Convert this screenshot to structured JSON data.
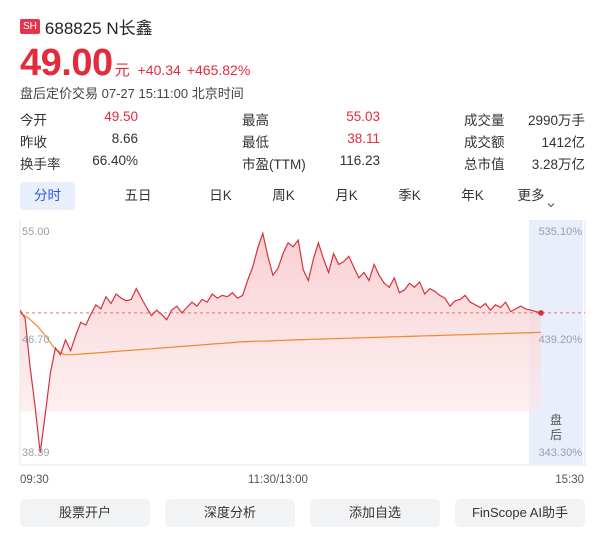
{
  "stock": {
    "exchange_badge": "SH",
    "code_name": "688825 N长鑫",
    "price": "49.00",
    "price_unit": "元",
    "change": "+40.34",
    "change_pct": "+465.82%",
    "trade_status": "盘后定价交易 07-27 15:11:00 北京时间"
  },
  "stats": [
    [
      {
        "label": "今开",
        "value": "49.50",
        "color": "red"
      },
      {
        "label": "最高",
        "value": "55.03",
        "color": "red"
      },
      {
        "label": "成交量",
        "value": "2990万手",
        "color": "normal"
      }
    ],
    [
      {
        "label": "昨收",
        "value": "8.66",
        "color": "normal"
      },
      {
        "label": "最低",
        "value": "38.11",
        "color": "red"
      },
      {
        "label": "成交额",
        "value": "1412亿",
        "color": "normal"
      }
    ],
    [
      {
        "label": "换手率",
        "value": "66.40%",
        "color": "normal"
      },
      {
        "label": "市盈(TTM)",
        "value": "116.23",
        "color": "normal"
      },
      {
        "label": "总市值",
        "value": "3.28万亿",
        "color": "normal"
      }
    ]
  ],
  "tabs": [
    "分时",
    "五日",
    "日K",
    "周K",
    "月K",
    "季K",
    "年K",
    "更多"
  ],
  "active_tab": 0,
  "chart": {
    "price_labels": [
      "55.00",
      "46.70",
      "38.39"
    ],
    "pct_labels": [
      "535.10%",
      "439.20%",
      "343.30%"
    ],
    "time_labels": [
      "09:30",
      "11:30/13:00",
      "15:30"
    ],
    "after_hours_label": [
      "盘",
      "后"
    ],
    "colors": {
      "price_line": "#d7313e",
      "avg_line": "#ee8a26",
      "ref_line": "#ea6f7a",
      "after_hours_bg": "#e9eefb",
      "label_color": "#9aa0a8"
    }
  },
  "chart_data": {
    "type": "line",
    "xlabel": "",
    "ylabel": "",
    "ylim": [
      38.39,
      55.0
    ],
    "reference_price": 49.0,
    "x_ticks": [
      "09:30",
      "11:30/13:00",
      "15:30"
    ],
    "series": [
      {
        "values": [
          49.2,
          48.6,
          45.0,
          42.0,
          38.6,
          41.5,
          44.5,
          46.4,
          45.9,
          47.0,
          46.2,
          47.3,
          48.3,
          48.1,
          48.9,
          49.6,
          49.3,
          50.2,
          49.7,
          50.4,
          50.1,
          49.9,
          50.0,
          50.8,
          50.1,
          49.4,
          48.8,
          49.2,
          48.9,
          48.5,
          49.2,
          49.5,
          49.0,
          49.4,
          49.8,
          49.5,
          50.0,
          49.8,
          50.4,
          50.1,
          50.3,
          50.2,
          50.5,
          50.1,
          50.3,
          51.4,
          52.4,
          53.8,
          54.9,
          53.2,
          51.8,
          52.3,
          53.4,
          54.2,
          53.9,
          54.4,
          52.2,
          51.4,
          53.0,
          54.2,
          53.0,
          52.0,
          53.4,
          52.6,
          52.8,
          53.2,
          52.4,
          51.6,
          52.0,
          51.4,
          52.6,
          51.8,
          51.2,
          50.9,
          51.6,
          50.5,
          50.7,
          51.2,
          50.9,
          51.3,
          50.4,
          50.8,
          50.6,
          50.3,
          50.1,
          49.5,
          49.9,
          50.0,
          50.3,
          49.8,
          49.6,
          49.4,
          49.7,
          49.2,
          49.6,
          49.4,
          49.8,
          49.1,
          49.3,
          49.5,
          49.3,
          49.2,
          49.1,
          49.0
        ]
      },
      {
        "values": [
          49.0,
          48.6,
          48.0,
          47.2,
          46.3,
          45.9,
          45.9,
          45.95,
          46.0,
          46.05,
          46.1,
          46.15,
          46.2,
          46.25,
          46.3,
          46.35,
          46.4,
          46.45,
          46.5,
          46.55,
          46.6,
          46.65,
          46.7,
          46.75,
          46.8,
          46.85,
          46.88,
          46.9,
          46.92,
          46.95,
          46.97,
          47.0,
          47.02,
          47.04,
          47.06,
          47.08,
          47.1,
          47.12,
          47.14,
          47.16,
          47.18,
          47.2,
          47.22,
          47.24,
          47.26,
          47.28,
          47.3,
          47.32,
          47.34,
          47.36,
          47.38,
          47.4,
          47.42,
          47.44,
          47.46,
          47.48,
          47.5,
          47.52,
          47.54,
          47.56
        ]
      }
    ]
  },
  "buttons": [
    "股票开户",
    "深度分析",
    "添加自选",
    "FinScope AI助手"
  ]
}
